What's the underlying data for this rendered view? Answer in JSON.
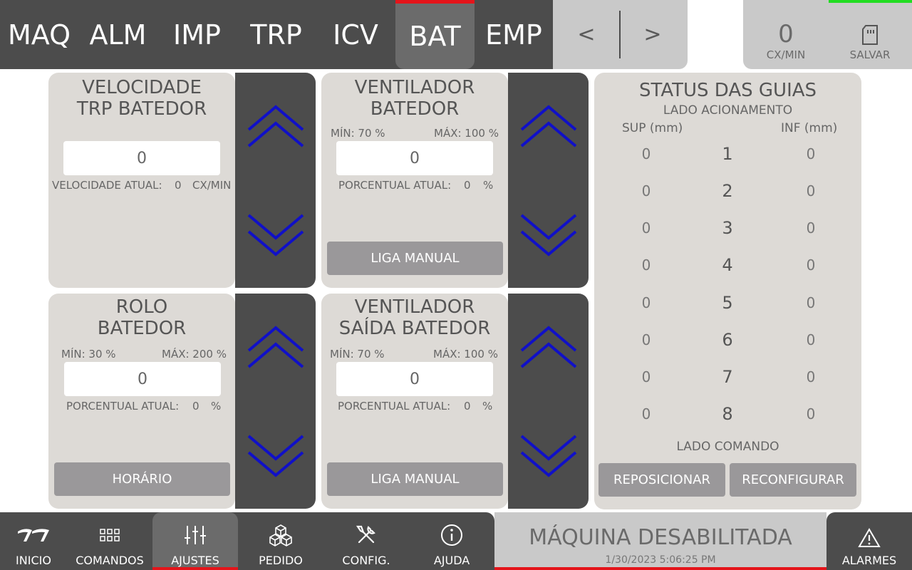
{
  "top_tabs": [
    "MAQ",
    "ALM",
    "IMP",
    "TRP",
    "ICV",
    "BAT",
    "EMP"
  ],
  "active_tab": "BAT",
  "pager": {
    "prev": "<",
    "next": ">"
  },
  "speed": {
    "value": "0",
    "unit": "CX/MIN"
  },
  "save": {
    "label": "SALVAR"
  },
  "panels": {
    "vel_trp": {
      "title1": "VELOCIDADE",
      "title2": "TRP BATEDOR",
      "value": "0",
      "current_label": "VELOCIDADE ATUAL:",
      "current_value": "0",
      "current_unit": "CX/MIN"
    },
    "vent_bat": {
      "title1": "VENTILADOR",
      "title2": "BATEDOR",
      "min": "MÍN: 70 %",
      "max": "MÁX: 100 %",
      "value": "0",
      "current_label": "PORCENTUAL ATUAL:",
      "current_value": "0",
      "current_unit": "%",
      "button": "LIGA MANUAL"
    },
    "rolo": {
      "title1": "ROLO",
      "title2": "BATEDOR",
      "min": "MÍN: 30 %",
      "max": "MÁX: 200 %",
      "value": "0",
      "current_label": "PORCENTUAL ATUAL:",
      "current_value": "0",
      "current_unit": "%",
      "button": "HORÁRIO"
    },
    "vent_saida": {
      "title1": "VENTILADOR",
      "title2": "SAÍDA BATEDOR",
      "min": "MÍN: 70 %",
      "max": "MÁX: 100 %",
      "value": "0",
      "current_label": "PORCENTUAL ATUAL:",
      "current_value": "0",
      "current_unit": "%",
      "button": "LIGA MANUAL"
    }
  },
  "arrow_color": "#1010c8",
  "status": {
    "title": "STATUS DAS GUIAS",
    "subtitle": "LADO ACIONAMENTO",
    "sup_header": "SUP (mm)",
    "inf_header": "INF (mm)",
    "rows": [
      {
        "sup": "0",
        "num": "1",
        "inf": "0"
      },
      {
        "sup": "0",
        "num": "2",
        "inf": "0"
      },
      {
        "sup": "0",
        "num": "3",
        "inf": "0"
      },
      {
        "sup": "0",
        "num": "4",
        "inf": "0"
      },
      {
        "sup": "0",
        "num": "5",
        "inf": "0"
      },
      {
        "sup": "0",
        "num": "6",
        "inf": "0"
      },
      {
        "sup": "0",
        "num": "7",
        "inf": "0"
      },
      {
        "sup": "0",
        "num": "8",
        "inf": "0"
      }
    ],
    "footer": "LADO COMANDO",
    "btn_reposition": "REPOSICIONAR",
    "btn_reconfigure": "RECONFIGURAR"
  },
  "bottom_nav": [
    {
      "label": "INICIO",
      "icon": "logo-icon"
    },
    {
      "label": "COMANDOS",
      "icon": "grid-icon"
    },
    {
      "label": "AJUSTES",
      "icon": "sliders-icon"
    },
    {
      "label": "PEDIDO",
      "icon": "boxes-icon"
    },
    {
      "label": "CONFIG.",
      "icon": "tools-icon"
    },
    {
      "label": "AJUDA",
      "icon": "info-icon"
    }
  ],
  "active_bottom": "AJUSTES",
  "machine_status": {
    "text": "MÁQUINA DESABILITADA",
    "datetime": "1/30/2023 5:06:25 PM"
  },
  "alarms": {
    "label": "ALARMES"
  }
}
